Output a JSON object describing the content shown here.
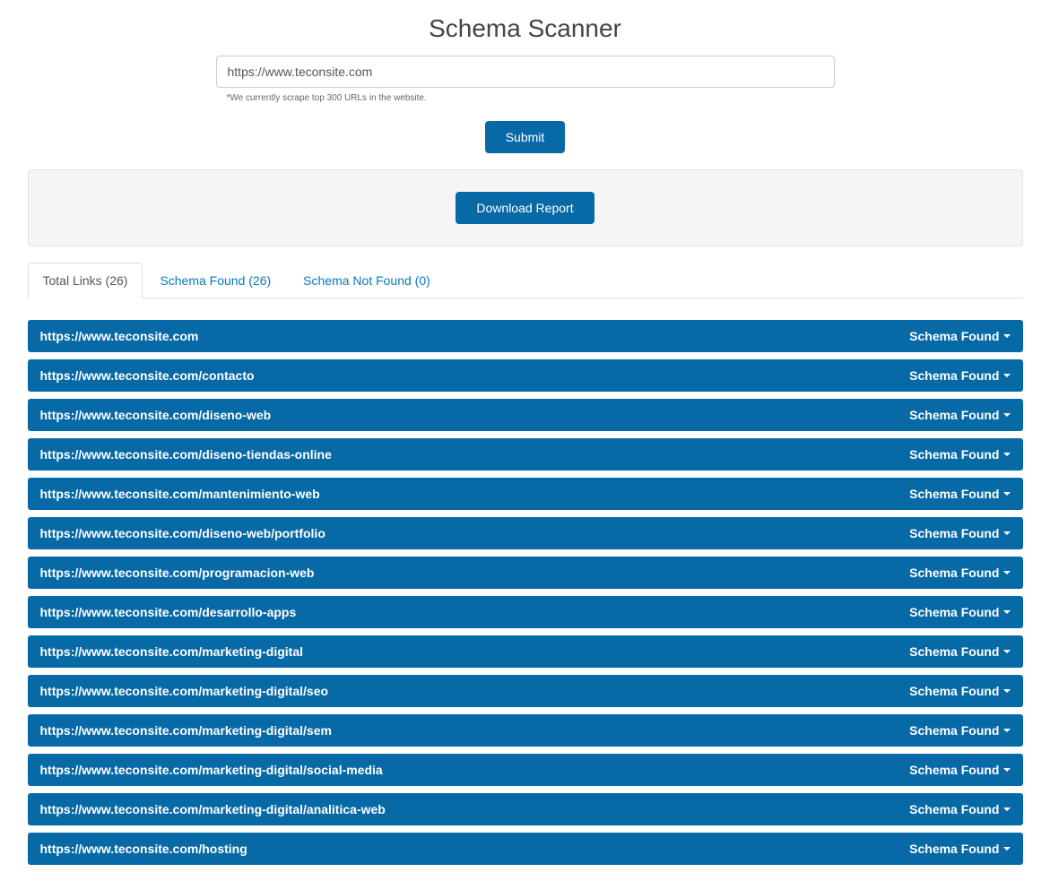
{
  "header": {
    "title": "Schema Scanner"
  },
  "form": {
    "url_value": "https://www.teconsite.com",
    "note": "*We currently scrape top 300 URLs in the website.",
    "submit_label": "Submit"
  },
  "report": {
    "download_label": "Download Report"
  },
  "tabs": {
    "total_label": "Total Links (26)",
    "found_label": "Schema Found (26)",
    "notfound_label": "Schema Not Found (0)"
  },
  "status_label": "Schema Found",
  "results": [
    {
      "url": "https://www.teconsite.com"
    },
    {
      "url": "https://www.teconsite.com/contacto"
    },
    {
      "url": "https://www.teconsite.com/diseno-web"
    },
    {
      "url": "https://www.teconsite.com/diseno-tiendas-online"
    },
    {
      "url": "https://www.teconsite.com/mantenimiento-web"
    },
    {
      "url": "https://www.teconsite.com/diseno-web/portfolio"
    },
    {
      "url": "https://www.teconsite.com/programacion-web"
    },
    {
      "url": "https://www.teconsite.com/desarrollo-apps"
    },
    {
      "url": "https://www.teconsite.com/marketing-digital"
    },
    {
      "url": "https://www.teconsite.com/marketing-digital/seo"
    },
    {
      "url": "https://www.teconsite.com/marketing-digital/sem"
    },
    {
      "url": "https://www.teconsite.com/marketing-digital/social-media"
    },
    {
      "url": "https://www.teconsite.com/marketing-digital/analitica-web"
    },
    {
      "url": "https://www.teconsite.com/hosting"
    }
  ]
}
